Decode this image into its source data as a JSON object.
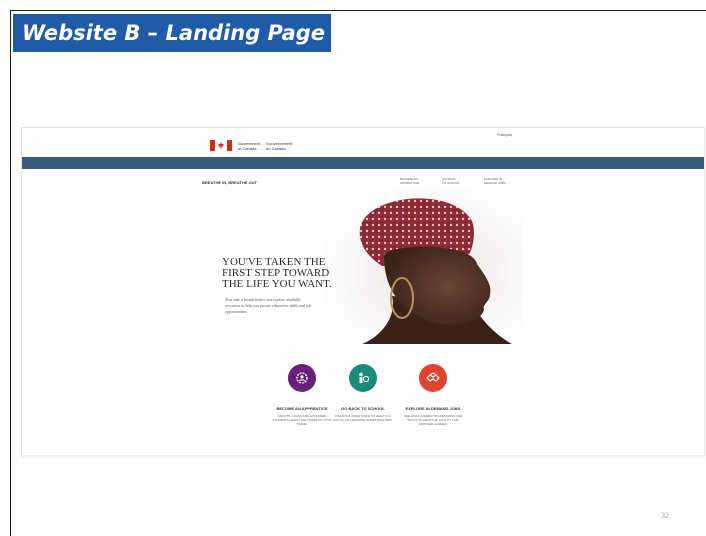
{
  "slide": {
    "title": "Website B – Landing Page",
    "page_number": "32"
  },
  "site": {
    "language_toggle": "Français",
    "gov_en": [
      "Government",
      "of Canada"
    ],
    "gov_fr": [
      "Gouvernement",
      "du Canada"
    ],
    "campaign_title": "BREATHE IN, BREATHE OUT",
    "nav_links": [
      [
        "BECOME AN",
        "APPRENTICE"
      ],
      [
        "GO BACK",
        "TO SCHOOL"
      ],
      [
        "EXPLORE IN",
        "DEMAND JOBS"
      ]
    ],
    "headline": [
      "YOU'VE TAKEN THE",
      "FIRST STEP TOWARD",
      "THE LIFE YOU WANT."
    ],
    "subline": "Now take a breath before you explore available resources to help you pursue education, skills and job opportunities.",
    "features": [
      {
        "label": "BECOME AN APPRENTICE",
        "desc": "GRANTS, LOANS AND EXTENDED STUDENTS LEARN THE TRADE OF YOUR TRADE.",
        "color": "#6a1f7a",
        "icon": "gear-person-icon"
      },
      {
        "label": "GO BACK TO SCHOOL",
        "desc": "FINANCIAL ASSISTANCE TO HELP YOU FOCUS ON LEARNING SOMETHING NEW.",
        "color": "#1b8a7a",
        "icon": "student-icon"
      },
      {
        "label": "EXPLORE IN DEMAND JOBS",
        "desc": "SEE WHAT CAREER PROFESSIONS AND TOOLS TO HELP THE QUALITY FOR ANOTHER CAREER.",
        "color": "#e0432f",
        "icon": "handshake-icon"
      }
    ]
  }
}
